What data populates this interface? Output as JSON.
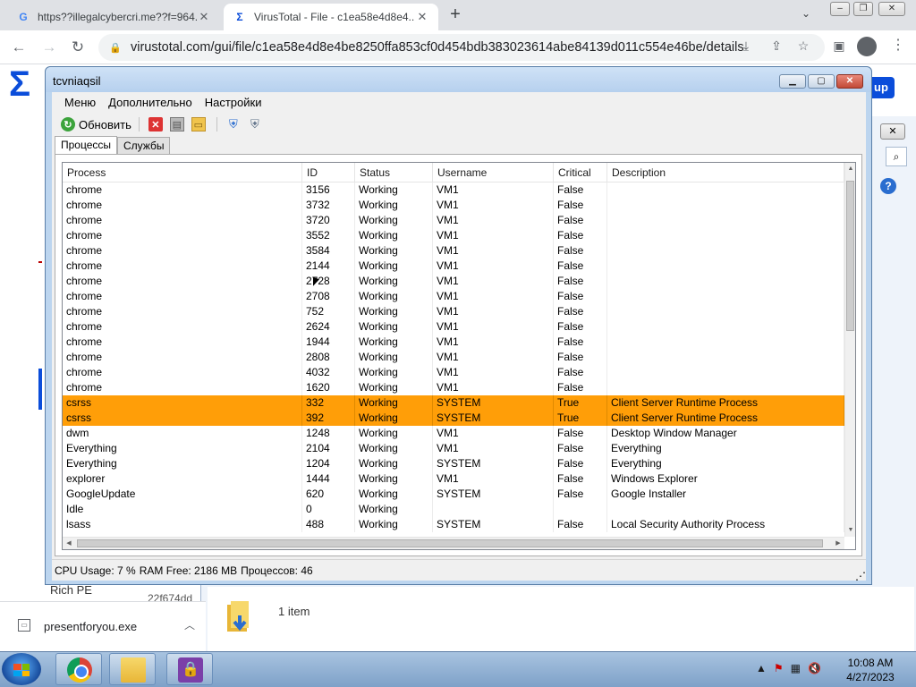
{
  "browser": {
    "tabs": [
      {
        "label": "https??illegalcybercri.me??f=964...",
        "favicon": "google-g",
        "active": false
      },
      {
        "label": "VirusTotal - File - c1ea58e4d8e4...",
        "favicon": "virustotal-sigma",
        "active": true
      }
    ],
    "new_tab_label": "+",
    "url": "virustotal.com/gui/file/c1ea58e4d8e4be8250ffa853cf0d454bdb383023614abe84139d011c554e46be/details"
  },
  "vt_page": {
    "signup_label": "up",
    "rich_pe_label": "Rich PE",
    "hash_fragment": "22f674dd"
  },
  "explorer": {
    "item_count": "1 item"
  },
  "download": {
    "filename": "presentforyou.exe"
  },
  "app": {
    "title": "tcvniaqsil",
    "menu": [
      "Меню",
      "Дополнительно",
      "Настройки"
    ],
    "toolbar": {
      "refresh_label": "Обновить"
    },
    "tabs": [
      "Процессы",
      "Службы"
    ],
    "columns": [
      "Process",
      "ID",
      "Status",
      "Username",
      "Critical",
      "Description"
    ],
    "rows": [
      {
        "process": "chrome",
        "id": "3156",
        "status": "Working",
        "user": "VM1",
        "critical": "False",
        "desc": ""
      },
      {
        "process": "chrome",
        "id": "3732",
        "status": "Working",
        "user": "VM1",
        "critical": "False",
        "desc": ""
      },
      {
        "process": "chrome",
        "id": "3720",
        "status": "Working",
        "user": "VM1",
        "critical": "False",
        "desc": ""
      },
      {
        "process": "chrome",
        "id": "3552",
        "status": "Working",
        "user": "VM1",
        "critical": "False",
        "desc": ""
      },
      {
        "process": "chrome",
        "id": "3584",
        "status": "Working",
        "user": "VM1",
        "critical": "False",
        "desc": ""
      },
      {
        "process": "chrome",
        "id": "2144",
        "status": "Working",
        "user": "VM1",
        "critical": "False",
        "desc": ""
      },
      {
        "process": "chrome",
        "id": "2728",
        "status": "Working",
        "user": "VM1",
        "critical": "False",
        "desc": ""
      },
      {
        "process": "chrome",
        "id": "2708",
        "status": "Working",
        "user": "VM1",
        "critical": "False",
        "desc": ""
      },
      {
        "process": "chrome",
        "id": "752",
        "status": "Working",
        "user": "VM1",
        "critical": "False",
        "desc": ""
      },
      {
        "process": "chrome",
        "id": "2624",
        "status": "Working",
        "user": "VM1",
        "critical": "False",
        "desc": ""
      },
      {
        "process": "chrome",
        "id": "1944",
        "status": "Working",
        "user": "VM1",
        "critical": "False",
        "desc": ""
      },
      {
        "process": "chrome",
        "id": "2808",
        "status": "Working",
        "user": "VM1",
        "critical": "False",
        "desc": ""
      },
      {
        "process": "chrome",
        "id": "4032",
        "status": "Working",
        "user": "VM1",
        "critical": "False",
        "desc": ""
      },
      {
        "process": "chrome",
        "id": "1620",
        "status": "Working",
        "user": "VM1",
        "critical": "False",
        "desc": ""
      },
      {
        "process": "csrss",
        "id": "332",
        "status": "Working",
        "user": "SYSTEM",
        "critical": "True",
        "desc": "Client Server Runtime Process"
      },
      {
        "process": "csrss",
        "id": "392",
        "status": "Working",
        "user": "SYSTEM",
        "critical": "True",
        "desc": "Client Server Runtime Process"
      },
      {
        "process": "dwm",
        "id": "1248",
        "status": "Working",
        "user": "VM1",
        "critical": "False",
        "desc": "Desktop Window Manager"
      },
      {
        "process": "Everything",
        "id": "2104",
        "status": "Working",
        "user": "VM1",
        "critical": "False",
        "desc": "Everything"
      },
      {
        "process": "Everything",
        "id": "1204",
        "status": "Working",
        "user": "SYSTEM",
        "critical": "False",
        "desc": "Everything"
      },
      {
        "process": "explorer",
        "id": "1444",
        "status": "Working",
        "user": "VM1",
        "critical": "False",
        "desc": "Windows Explorer"
      },
      {
        "process": "GoogleUpdate",
        "id": "620",
        "status": "Working",
        "user": "SYSTEM",
        "critical": "False",
        "desc": "Google Installer"
      },
      {
        "process": "Idle",
        "id": "0",
        "status": "Working",
        "user": "",
        "critical": "",
        "desc": ""
      },
      {
        "process": "lsass",
        "id": "488",
        "status": "Working",
        "user": "SYSTEM",
        "critical": "False",
        "desc": "Local Security Authority Process"
      }
    ],
    "critical_color": "#ff9e08",
    "status": {
      "cpu": "CPU Usage: 7 %",
      "ram": "RAM Free: 2186 MB",
      "count": "Процессов: 46"
    }
  },
  "taskbar": {
    "time": "10:08 AM",
    "date": "4/27/2023",
    "apps": [
      "chrome-icon",
      "explorer-folder-icon",
      "lock-app-icon"
    ]
  }
}
